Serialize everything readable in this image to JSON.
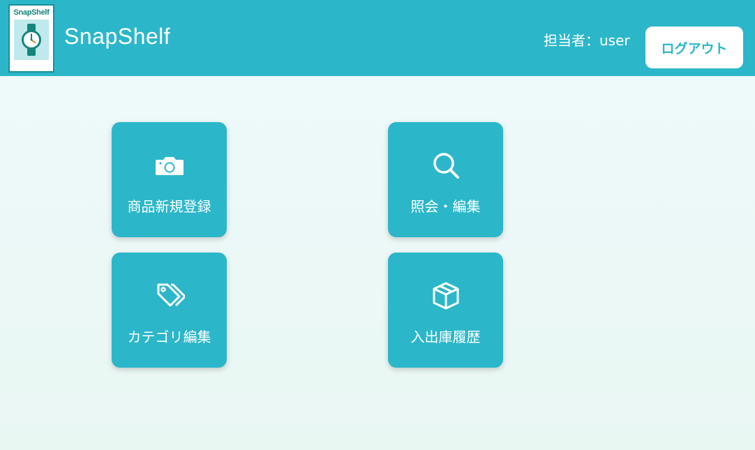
{
  "header": {
    "logo_text": "SnapShelf",
    "app_title": "SnapShelf",
    "user_label": "担当者：user",
    "logout_label": "ログアウト",
    "logo_icon": "wristwatch-icon"
  },
  "menu": {
    "tiles": [
      {
        "label": "商品新規登録",
        "icon": "camera-icon"
      },
      {
        "label": "照会・編集",
        "icon": "search-icon"
      },
      {
        "label": "カテゴリ編集",
        "icon": "tags-icon"
      },
      {
        "label": "入出庫履歴",
        "icon": "box-icon"
      }
    ]
  },
  "colors": {
    "accent": "#2bb7c9",
    "background": "#effafb",
    "white": "#ffffff",
    "logo_green": "#16857a"
  }
}
